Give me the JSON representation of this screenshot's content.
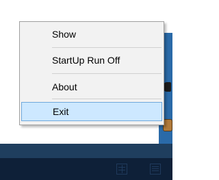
{
  "context_menu": {
    "items": [
      {
        "label": "Show"
      },
      {
        "label": "StartUp Run Off"
      },
      {
        "label": "About"
      },
      {
        "label": "Exit"
      }
    ],
    "highlighted_item": "Exit"
  },
  "taskbar": {
    "icons": [
      "reader-icon",
      "list-icon"
    ]
  },
  "colors": {
    "menu_background": "#f2f2f2",
    "highlight": "#cde8ff",
    "highlight_border": "#6fa8dc",
    "window_accent": "#2a6aa8",
    "taskbar": "#0e2038"
  }
}
